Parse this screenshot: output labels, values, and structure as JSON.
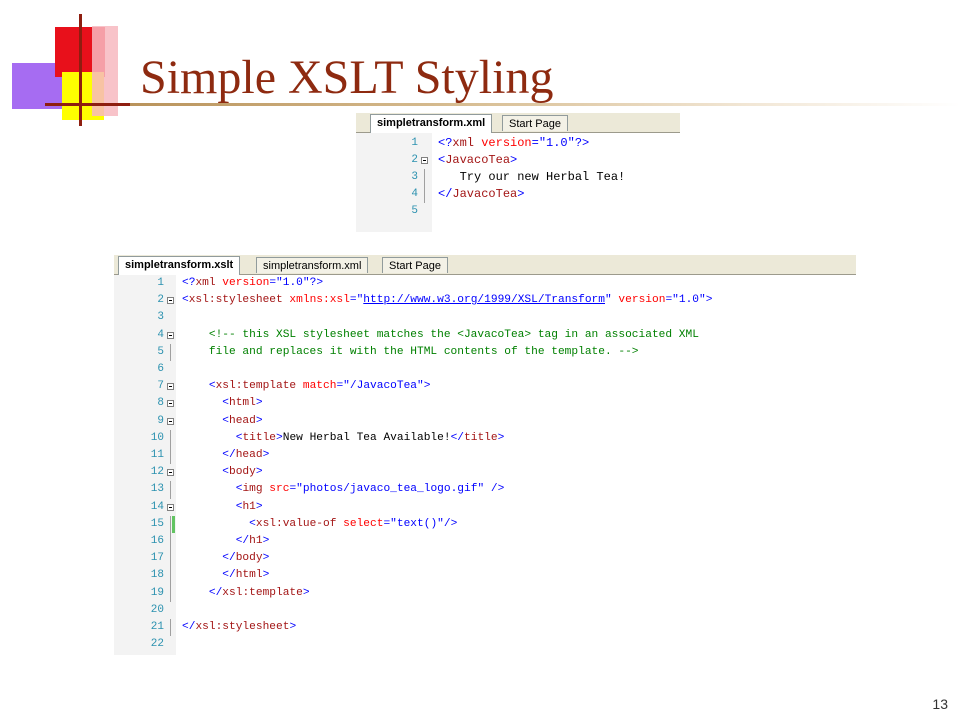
{
  "slide": {
    "title": "Simple XSLT Styling",
    "page_number": "13"
  },
  "colors": {
    "title": "#8e2a10",
    "accent_red": "#e8101b",
    "accent_yellow": "#ffff00",
    "accent_purple": "#a66cf2"
  },
  "xml_window": {
    "tabs": [
      "simpletransform.xml",
      "Start Page"
    ],
    "active_tab": 0,
    "lines": [
      {
        "n": "1",
        "code": [
          {
            "t": "<?",
            "c": "blue"
          },
          {
            "t": "xml",
            "c": "maroon"
          },
          {
            "t": " version",
            "c": "red"
          },
          {
            "t": "=",
            "c": "blue"
          },
          {
            "t": "\"1.0\"",
            "c": "blue"
          },
          {
            "t": "?>",
            "c": "blue"
          }
        ]
      },
      {
        "n": "2",
        "code": [
          {
            "t": "<",
            "c": "blue"
          },
          {
            "t": "JavacoTea",
            "c": "maroon"
          },
          {
            "t": ">",
            "c": "blue"
          }
        ]
      },
      {
        "n": "3",
        "code": [
          {
            "t": "   Try our new Herbal Tea!",
            "c": "black"
          }
        ]
      },
      {
        "n": "4",
        "code": [
          {
            "t": "</",
            "c": "blue"
          },
          {
            "t": "JavacoTea",
            "c": "maroon"
          },
          {
            "t": ">",
            "c": "blue"
          }
        ]
      },
      {
        "n": "5",
        "code": []
      }
    ]
  },
  "xslt_window": {
    "tabs": [
      "simpletransform.xslt",
      "simpletransform.xml",
      "Start Page"
    ],
    "active_tab": 0,
    "lines": [
      {
        "n": "1",
        "code": [
          {
            "t": "<?",
            "c": "blue"
          },
          {
            "t": "xml",
            "c": "maroon"
          },
          {
            "t": " version",
            "c": "red"
          },
          {
            "t": "=",
            "c": "blue"
          },
          {
            "t": "\"1.0\"",
            "c": "blue"
          },
          {
            "t": "?>",
            "c": "blue"
          }
        ]
      },
      {
        "n": "2",
        "code": [
          {
            "t": "<",
            "c": "blue"
          },
          {
            "t": "xsl:stylesheet",
            "c": "maroon"
          },
          {
            "t": " xmlns:xsl",
            "c": "red"
          },
          {
            "t": "=",
            "c": "blue"
          },
          {
            "t": "\"",
            "c": "blue"
          },
          {
            "t": "http://www.w3.org/1999/XSL/Transform",
            "c": "link"
          },
          {
            "t": "\"",
            "c": "blue"
          },
          {
            "t": " version",
            "c": "red"
          },
          {
            "t": "=",
            "c": "blue"
          },
          {
            "t": "\"1.0\"",
            "c": "blue"
          },
          {
            "t": ">",
            "c": "blue"
          }
        ]
      },
      {
        "n": "3",
        "code": []
      },
      {
        "n": "4",
        "code": [
          {
            "t": "    <!-- this XSL stylesheet matches the <JavacoTea> tag in an associated XML",
            "c": "green"
          }
        ]
      },
      {
        "n": "5",
        "code": [
          {
            "t": "    file and replaces it with the HTML contents of the template. -->",
            "c": "green"
          }
        ]
      },
      {
        "n": "6",
        "code": []
      },
      {
        "n": "7",
        "code": [
          {
            "t": "    <",
            "c": "blue"
          },
          {
            "t": "xsl:template",
            "c": "maroon"
          },
          {
            "t": " match",
            "c": "red"
          },
          {
            "t": "=",
            "c": "blue"
          },
          {
            "t": "\"/JavacoTea\"",
            "c": "blue"
          },
          {
            "t": ">",
            "c": "blue"
          }
        ]
      },
      {
        "n": "8",
        "code": [
          {
            "t": "      <",
            "c": "blue"
          },
          {
            "t": "html",
            "c": "maroon"
          },
          {
            "t": ">",
            "c": "blue"
          }
        ]
      },
      {
        "n": "9",
        "code": [
          {
            "t": "      <",
            "c": "blue"
          },
          {
            "t": "head",
            "c": "maroon"
          },
          {
            "t": ">",
            "c": "blue"
          }
        ]
      },
      {
        "n": "10",
        "code": [
          {
            "t": "        <",
            "c": "blue"
          },
          {
            "t": "title",
            "c": "maroon"
          },
          {
            "t": ">",
            "c": "blue"
          },
          {
            "t": "New Herbal Tea Available!",
            "c": "black"
          },
          {
            "t": "</",
            "c": "blue"
          },
          {
            "t": "title",
            "c": "maroon"
          },
          {
            "t": ">",
            "c": "blue"
          }
        ]
      },
      {
        "n": "11",
        "code": [
          {
            "t": "      </",
            "c": "blue"
          },
          {
            "t": "head",
            "c": "maroon"
          },
          {
            "t": ">",
            "c": "blue"
          }
        ]
      },
      {
        "n": "12",
        "code": [
          {
            "t": "      <",
            "c": "blue"
          },
          {
            "t": "body",
            "c": "maroon"
          },
          {
            "t": ">",
            "c": "blue"
          }
        ]
      },
      {
        "n": "13",
        "code": [
          {
            "t": "        <",
            "c": "blue"
          },
          {
            "t": "img",
            "c": "maroon"
          },
          {
            "t": " src",
            "c": "red"
          },
          {
            "t": "=",
            "c": "blue"
          },
          {
            "t": "\"photos/javaco_tea_logo.gif\"",
            "c": "blue"
          },
          {
            "t": " />",
            "c": "blue"
          }
        ]
      },
      {
        "n": "14",
        "code": [
          {
            "t": "        <",
            "c": "blue"
          },
          {
            "t": "h1",
            "c": "maroon"
          },
          {
            "t": ">",
            "c": "blue"
          }
        ]
      },
      {
        "n": "15",
        "code": [
          {
            "t": "          <",
            "c": "blue"
          },
          {
            "t": "xsl:value-of",
            "c": "maroon"
          },
          {
            "t": " select",
            "c": "red"
          },
          {
            "t": "=",
            "c": "blue"
          },
          {
            "t": "\"text()\"",
            "c": "blue"
          },
          {
            "t": "/>",
            "c": "blue"
          }
        ]
      },
      {
        "n": "16",
        "code": [
          {
            "t": "        </",
            "c": "blue"
          },
          {
            "t": "h1",
            "c": "maroon"
          },
          {
            "t": ">",
            "c": "blue"
          }
        ]
      },
      {
        "n": "17",
        "code": [
          {
            "t": "      </",
            "c": "blue"
          },
          {
            "t": "body",
            "c": "maroon"
          },
          {
            "t": ">",
            "c": "blue"
          }
        ]
      },
      {
        "n": "18",
        "code": [
          {
            "t": "      </",
            "c": "blue"
          },
          {
            "t": "html",
            "c": "maroon"
          },
          {
            "t": ">",
            "c": "blue"
          }
        ]
      },
      {
        "n": "19",
        "code": [
          {
            "t": "    </",
            "c": "blue"
          },
          {
            "t": "xsl:template",
            "c": "maroon"
          },
          {
            "t": ">",
            "c": "blue"
          }
        ]
      },
      {
        "n": "20",
        "code": []
      },
      {
        "n": "21",
        "code": [
          {
            "t": "</",
            "c": "blue"
          },
          {
            "t": "xsl:stylesheet",
            "c": "maroon"
          },
          {
            "t": ">",
            "c": "blue"
          }
        ]
      },
      {
        "n": "22",
        "code": []
      }
    ]
  }
}
